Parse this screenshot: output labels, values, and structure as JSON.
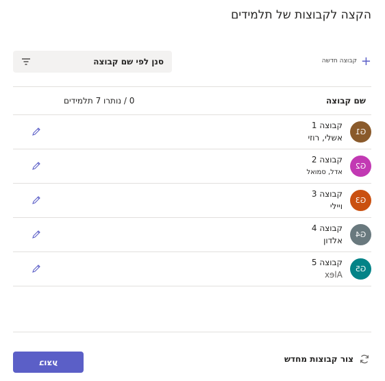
{
  "title": "הקצה לקבוצות של תלמידים",
  "toolbar": {
    "new_group_label": "קבוצה חדשה",
    "filter_placeholder": "סנן לפי שם קבוצה"
  },
  "table": {
    "col_group_name": "שם קבוצה",
    "col_remaining": "0 / נותרו 7 תלמידים",
    "rows": [
      {
        "avatar": "G1",
        "avatar_color": "#8a5a2b",
        "name": "קבוצה 1",
        "members": "אשלי, רוזי"
      },
      {
        "avatar": "G2",
        "avatar_color": "#c239b3",
        "name": "קבוצה 2",
        "members": "אדל, סמואל"
      },
      {
        "avatar": "G3",
        "avatar_color": "#ca5010",
        "name": "קבוצה 3",
        "members": "ויילי"
      },
      {
        "avatar": "G4",
        "avatar_color": "#69797e",
        "name": "קבוצה 4",
        "members": "אלדון"
      },
      {
        "avatar": "G5",
        "avatar_color": "#038387",
        "name": "קבוצה 5",
        "members": "Alex"
      }
    ]
  },
  "footer": {
    "regenerate_label": "צור קבוצות מחדש",
    "done_label": "בוצע"
  },
  "colors": {
    "accent": "#5b5fc7"
  },
  "icons": {
    "add": "plus-icon",
    "filter": "filter-icon",
    "edit": "pencil-icon",
    "regenerate": "refresh-icon"
  }
}
